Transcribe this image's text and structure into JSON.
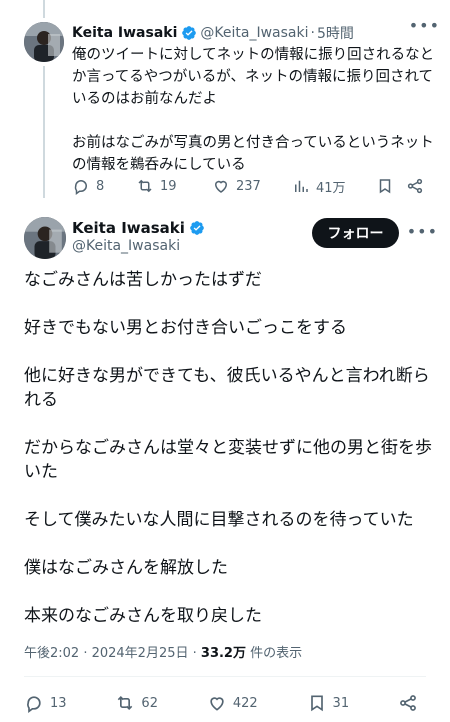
{
  "parent_tweet": {
    "author_name": "Keita Iwasaki",
    "handle": "@Keita_Iwasaki",
    "time": "5時間",
    "text_lines": [
      "俺のツイートに対してネットの情報に振り回されるなとか言ってるやつがいるが、ネットの情報に振り回されているのはお前なんだよ",
      "お前はなごみが写真の男と付き合っているというネットの情報を鵜呑みにしている"
    ],
    "replies": "8",
    "reposts": "19",
    "likes": "237",
    "views": "41万"
  },
  "main_tweet": {
    "author_name": "Keita Iwasaki",
    "handle": "@Keita_Iwasaki",
    "follow_label": "フォロー",
    "lines": [
      "なごみさんは苦しかったはずだ",
      "好きでもない男とお付き合いごっこをする",
      "他に好きな男ができても、彼氏いるやんと言われ断られる",
      "だからなごみさんは堂々と変装せずに他の男と街を歩いた",
      "そして僕みたいな人間に目撃されるのを待っていた",
      "僕はなごみさんを解放した",
      "本来のなごみさんを取り戻した"
    ],
    "timestamp": "午後2:02 · 2024年2月25日",
    "view_count": "33.2万",
    "view_suffix": "件の表示",
    "replies": "13",
    "reposts": "62",
    "likes": "422",
    "bookmarks": "31"
  },
  "colors": {
    "verified": "#1d9bf0",
    "text": "#0f1419",
    "muted": "#536471",
    "follow_bg": "#0f1419"
  },
  "icons": [
    "more-icon",
    "verified-icon",
    "reply-icon",
    "repost-icon",
    "like-icon",
    "views-icon",
    "bookmark-icon",
    "share-icon"
  ]
}
